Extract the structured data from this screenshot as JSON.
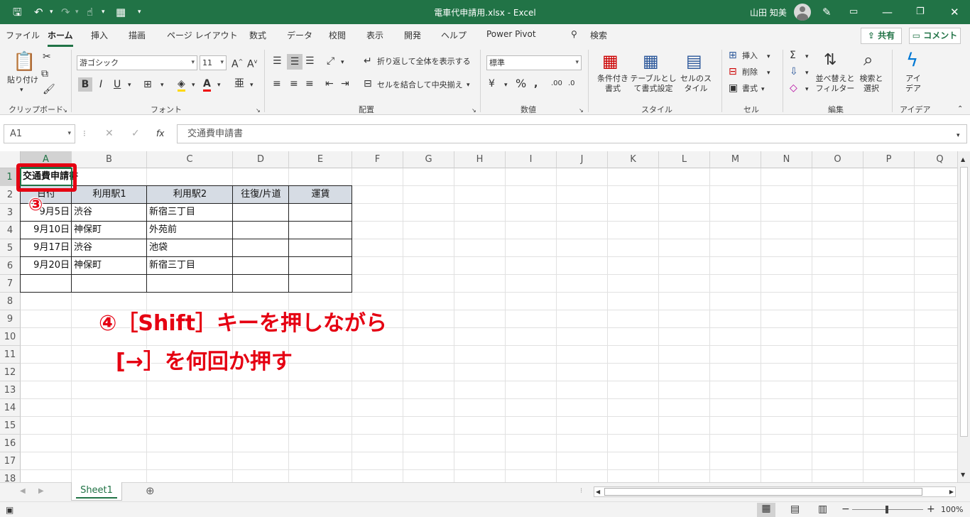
{
  "titlebar": {
    "file": "電車代申請用.xlsx",
    "sep": "-",
    "app": "Excel",
    "user": "山田 知美"
  },
  "tabs": [
    "ファイル",
    "ホーム",
    "挿入",
    "描画",
    "ページ レイアウト",
    "数式",
    "データ",
    "校閲",
    "表示",
    "開発",
    "ヘルプ",
    "Power Pivot",
    "検索"
  ],
  "share": "共有",
  "comment": "コメント",
  "ribbon": {
    "clipboard": {
      "paste": "貼り付け",
      "label": "クリップボード"
    },
    "font": {
      "name": "游ゴシック",
      "size": "11",
      "label": "フォント"
    },
    "align": {
      "wrap": "折り返して全体を表示する",
      "merge": "セルを結合して中央揃え",
      "label": "配置"
    },
    "number": {
      "format": "標準",
      "label": "数値"
    },
    "style": {
      "cond": "条件付き書式",
      "table": "テーブルとして書式設定",
      "cell": "セルのスタイル",
      "label": "スタイル"
    },
    "cells": {
      "insert": "挿入",
      "delete": "削除",
      "format": "書式",
      "label": "セル"
    },
    "edit": {
      "sort": "並べ替えとフィルター",
      "find": "検索と選択",
      "label": "編集"
    },
    "idea": {
      "btn": "アイデア",
      "label": "アイデア"
    }
  },
  "formula": {
    "namebox": "A1",
    "fx": "fx",
    "value": "交通費申請書"
  },
  "columns": [
    "A",
    "B",
    "C",
    "D",
    "E",
    "F",
    "G",
    "H",
    "I",
    "J",
    "K",
    "L",
    "M",
    "N",
    "O",
    "P",
    "Q"
  ],
  "rows": [
    "1",
    "2",
    "3",
    "4",
    "5",
    "6",
    "7",
    "8",
    "9",
    "10",
    "11",
    "12",
    "13",
    "14",
    "15",
    "16",
    "17",
    "18"
  ],
  "sheet": {
    "title": "交通費申請書",
    "headers": [
      "日付",
      "利用駅1",
      "利用駅2",
      "往復/片道",
      "運賃"
    ],
    "data": [
      [
        "9月5日",
        "渋谷",
        "新宿三丁目"
      ],
      [
        "9月10日",
        "神保町",
        "外苑前"
      ],
      [
        "9月17日",
        "渋谷",
        "池袋"
      ],
      [
        "9月20日",
        "神保町",
        "新宿三丁目"
      ]
    ]
  },
  "sheettab": "Sheet1",
  "zoom": "100%",
  "annotations": {
    "step3": "③",
    "step4_line1": "④［Shift］キーを押しながら",
    "step4_line2": "[→］を何回か押す"
  }
}
